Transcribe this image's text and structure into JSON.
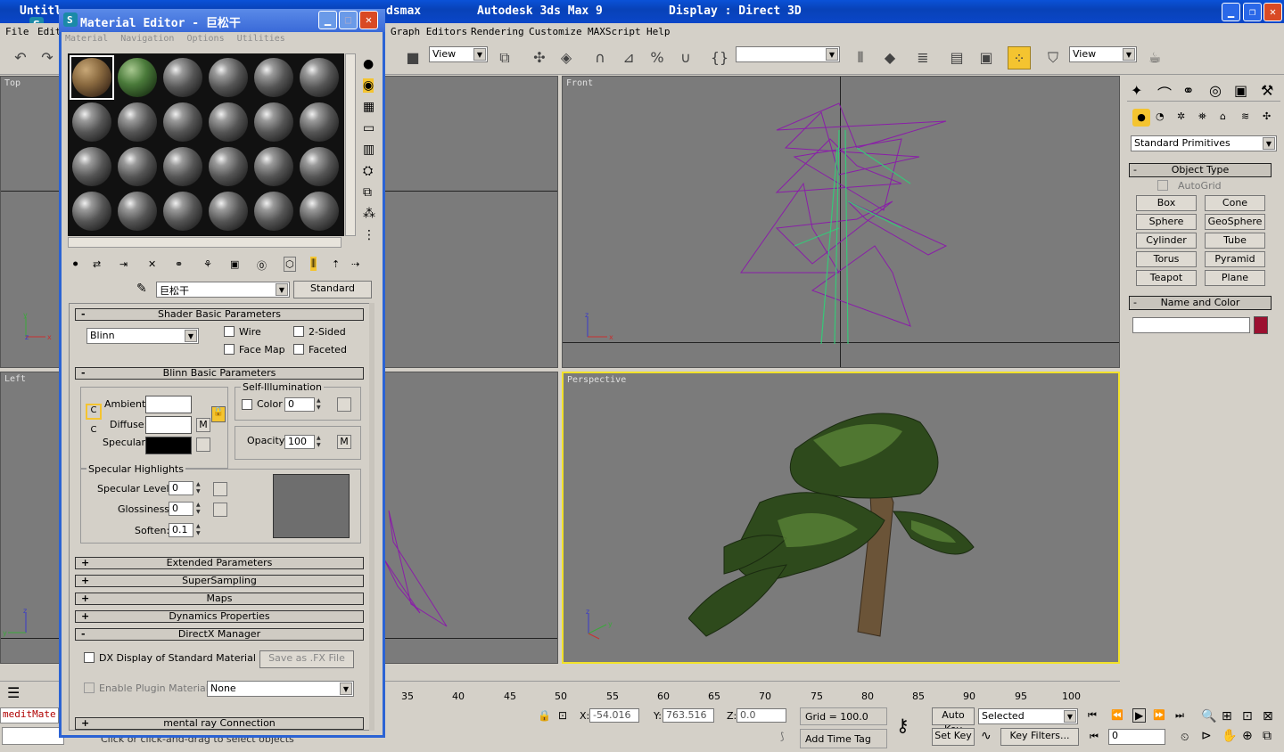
{
  "app": {
    "title_left": "Untitl",
    "title_mid": "dsmax",
    "title_app": "Autodesk 3ds Max 9",
    "title_display": "Display : Direct 3D"
  },
  "menu": [
    "File",
    "Edit",
    "Graph Editors",
    "Rendering",
    "Customize",
    "MAXScript",
    "Help"
  ],
  "toolbar": {
    "view_dd1": "View",
    "view_dd2": "View",
    "selection_set": ""
  },
  "viewports": {
    "top": "Top",
    "front": "Front",
    "left": "Left",
    "perspective": "Perspective"
  },
  "cmd": {
    "category": "Standard Primitives",
    "object_type": "Object Type",
    "autogrid": "AutoGrid",
    "buttons": [
      "Box",
      "Cone",
      "Sphere",
      "GeoSphere",
      "Cylinder",
      "Tube",
      "Torus",
      "Pyramid",
      "Teapot",
      "Plane"
    ],
    "name_color": "Name and Color",
    "obj_name": "",
    "obj_color": "#9c1030"
  },
  "mated": {
    "title": "Material Editor - 巨松干",
    "menu": [
      "Material",
      "Navigation",
      "Options",
      "Utilities"
    ],
    "mat_name": "巨松干",
    "mat_type": "Standard",
    "shader_hdr": "Shader Basic Parameters",
    "shader": "Blinn",
    "wire": "Wire",
    "two_sided": "2-Sided",
    "face_map": "Face Map",
    "faceted": "Faceted",
    "blinn_hdr": "Blinn Basic Parameters",
    "self_illum": "Self-Illumination",
    "color": "Color",
    "illum_val": "0",
    "ambient": "Ambient:",
    "diffuse": "Diffuse:",
    "specular": "Specular:",
    "m": "M",
    "opacity": "Opacity:",
    "opacity_val": "100",
    "spec_hl": "Specular Highlights",
    "spec_level": "Specular Level:",
    "spec_level_val": "0",
    "glossiness": "Glossiness:",
    "gloss_val": "0",
    "soften": "Soften:",
    "soften_val": "0.1",
    "rollouts": [
      "Extended Parameters",
      "SuperSampling",
      "Maps",
      "Dynamics Properties",
      "DirectX Manager"
    ],
    "dx_display": "DX Display of Standard Material",
    "save_fx": "Save as .FX File",
    "enable_plugin": "Enable Plugin Material",
    "plugin_val": "None",
    "mental_ray": "mental ray Connection"
  },
  "bottom": {
    "ticks": [
      "35",
      "40",
      "45",
      "50",
      "55",
      "60",
      "65",
      "70",
      "75",
      "80",
      "85",
      "90",
      "95",
      "100"
    ],
    "maxscript": "meditMate",
    "status": "Click or click-and-drag to select objects",
    "x_label": "X:",
    "x": "-54.016",
    "y_label": "Y:",
    "y": "763.516",
    "z_label": "Z:",
    "z": "0.0",
    "grid": "Grid = 100.0",
    "add_time_tag": "Add Time Tag",
    "auto_key": "Auto Key",
    "set_key": "Set Key",
    "selected": "Selected",
    "key_filters": "Key Filters...",
    "frame": "0"
  }
}
